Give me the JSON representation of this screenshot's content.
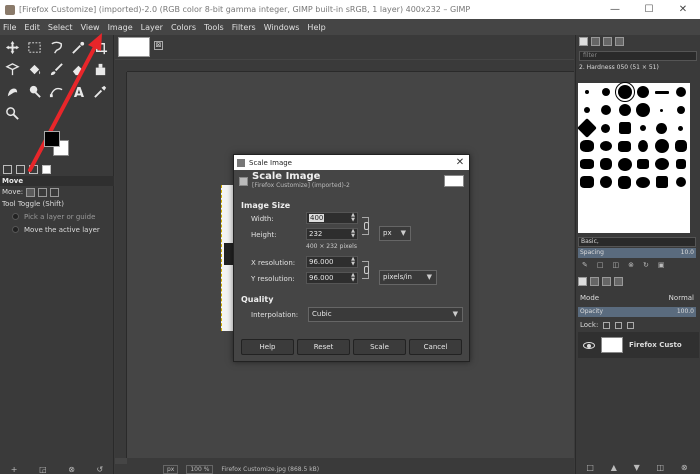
{
  "window": {
    "title": "[Firefox Customize] (imported)-2.0 (RGB color 8-bit gamma integer, GIMP built-in sRGB, 1 layer) 400x232 – GIMP",
    "minimize": "—",
    "maximize": "☐",
    "close": "✕"
  },
  "menu": [
    "File",
    "Edit",
    "Select",
    "View",
    "Image",
    "Layer",
    "Colors",
    "Tools",
    "Filters",
    "Windows",
    "Help"
  ],
  "tool_options": {
    "title": "Move",
    "move_label": "Move:",
    "toggle_label": "Tool Toggle  (Shift)",
    "option_pick": "Pick a layer or guide",
    "option_move": "Move the active layer"
  },
  "image_tab": {
    "close": "⊠"
  },
  "status": {
    "unit": "px",
    "zoom": "100 %",
    "file": "Firefox Customize.jpg (868.5 kB)"
  },
  "brushes": {
    "filter_placeholder": "filter",
    "brush_name": "2. Hardness 050 (51 × 51)",
    "preset": "Basic,",
    "spacing_label": "Spacing",
    "spacing_value": "10.0"
  },
  "layers": {
    "mode_label": "Mode",
    "mode_value": "Normal",
    "opacity_label": "Opacity",
    "opacity_value": "100.0",
    "lock_label": "Lock:",
    "layer_name": "Firefox Custo"
  },
  "dialog": {
    "window_title": "Scale Image",
    "heading": "Scale Image",
    "subheading": "[Firefox Customize] (imported)-2",
    "section_image_size": "Image Size",
    "width_label": "Width:",
    "width_value": "400",
    "height_label": "Height:",
    "height_value": "232",
    "size_unit": "px",
    "pixel_info": "400 × 232 pixels",
    "xres_label": "X resolution:",
    "xres_value": "96.000",
    "yres_label": "Y resolution:",
    "yres_value": "96.000",
    "res_unit": "pixels/in",
    "section_quality": "Quality",
    "interp_label": "Interpolation:",
    "interp_value": "Cubic",
    "btn_help": "Help",
    "btn_reset": "Reset",
    "btn_scale": "Scale",
    "btn_cancel": "Cancel"
  },
  "annotation": {
    "arrow_color": "#e8262a"
  }
}
